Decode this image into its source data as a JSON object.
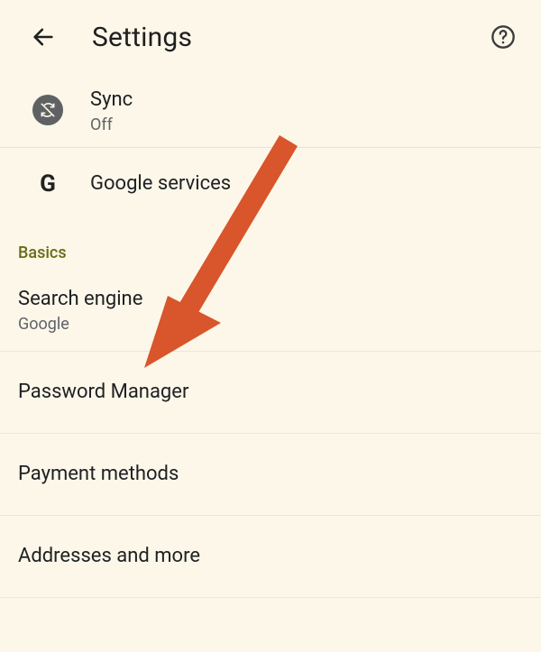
{
  "header": {
    "title": "Settings"
  },
  "rows": {
    "sync": {
      "title": "Sync",
      "subtitle": "Off"
    },
    "google_services": {
      "title": "Google services"
    }
  },
  "sections": {
    "basics": {
      "label": "Basics",
      "items": {
        "search_engine": {
          "title": "Search engine",
          "subtitle": "Google"
        },
        "password_manager": {
          "title": "Password Manager"
        },
        "payment_methods": {
          "title": "Payment methods"
        },
        "addresses": {
          "title": "Addresses and more"
        }
      }
    }
  }
}
